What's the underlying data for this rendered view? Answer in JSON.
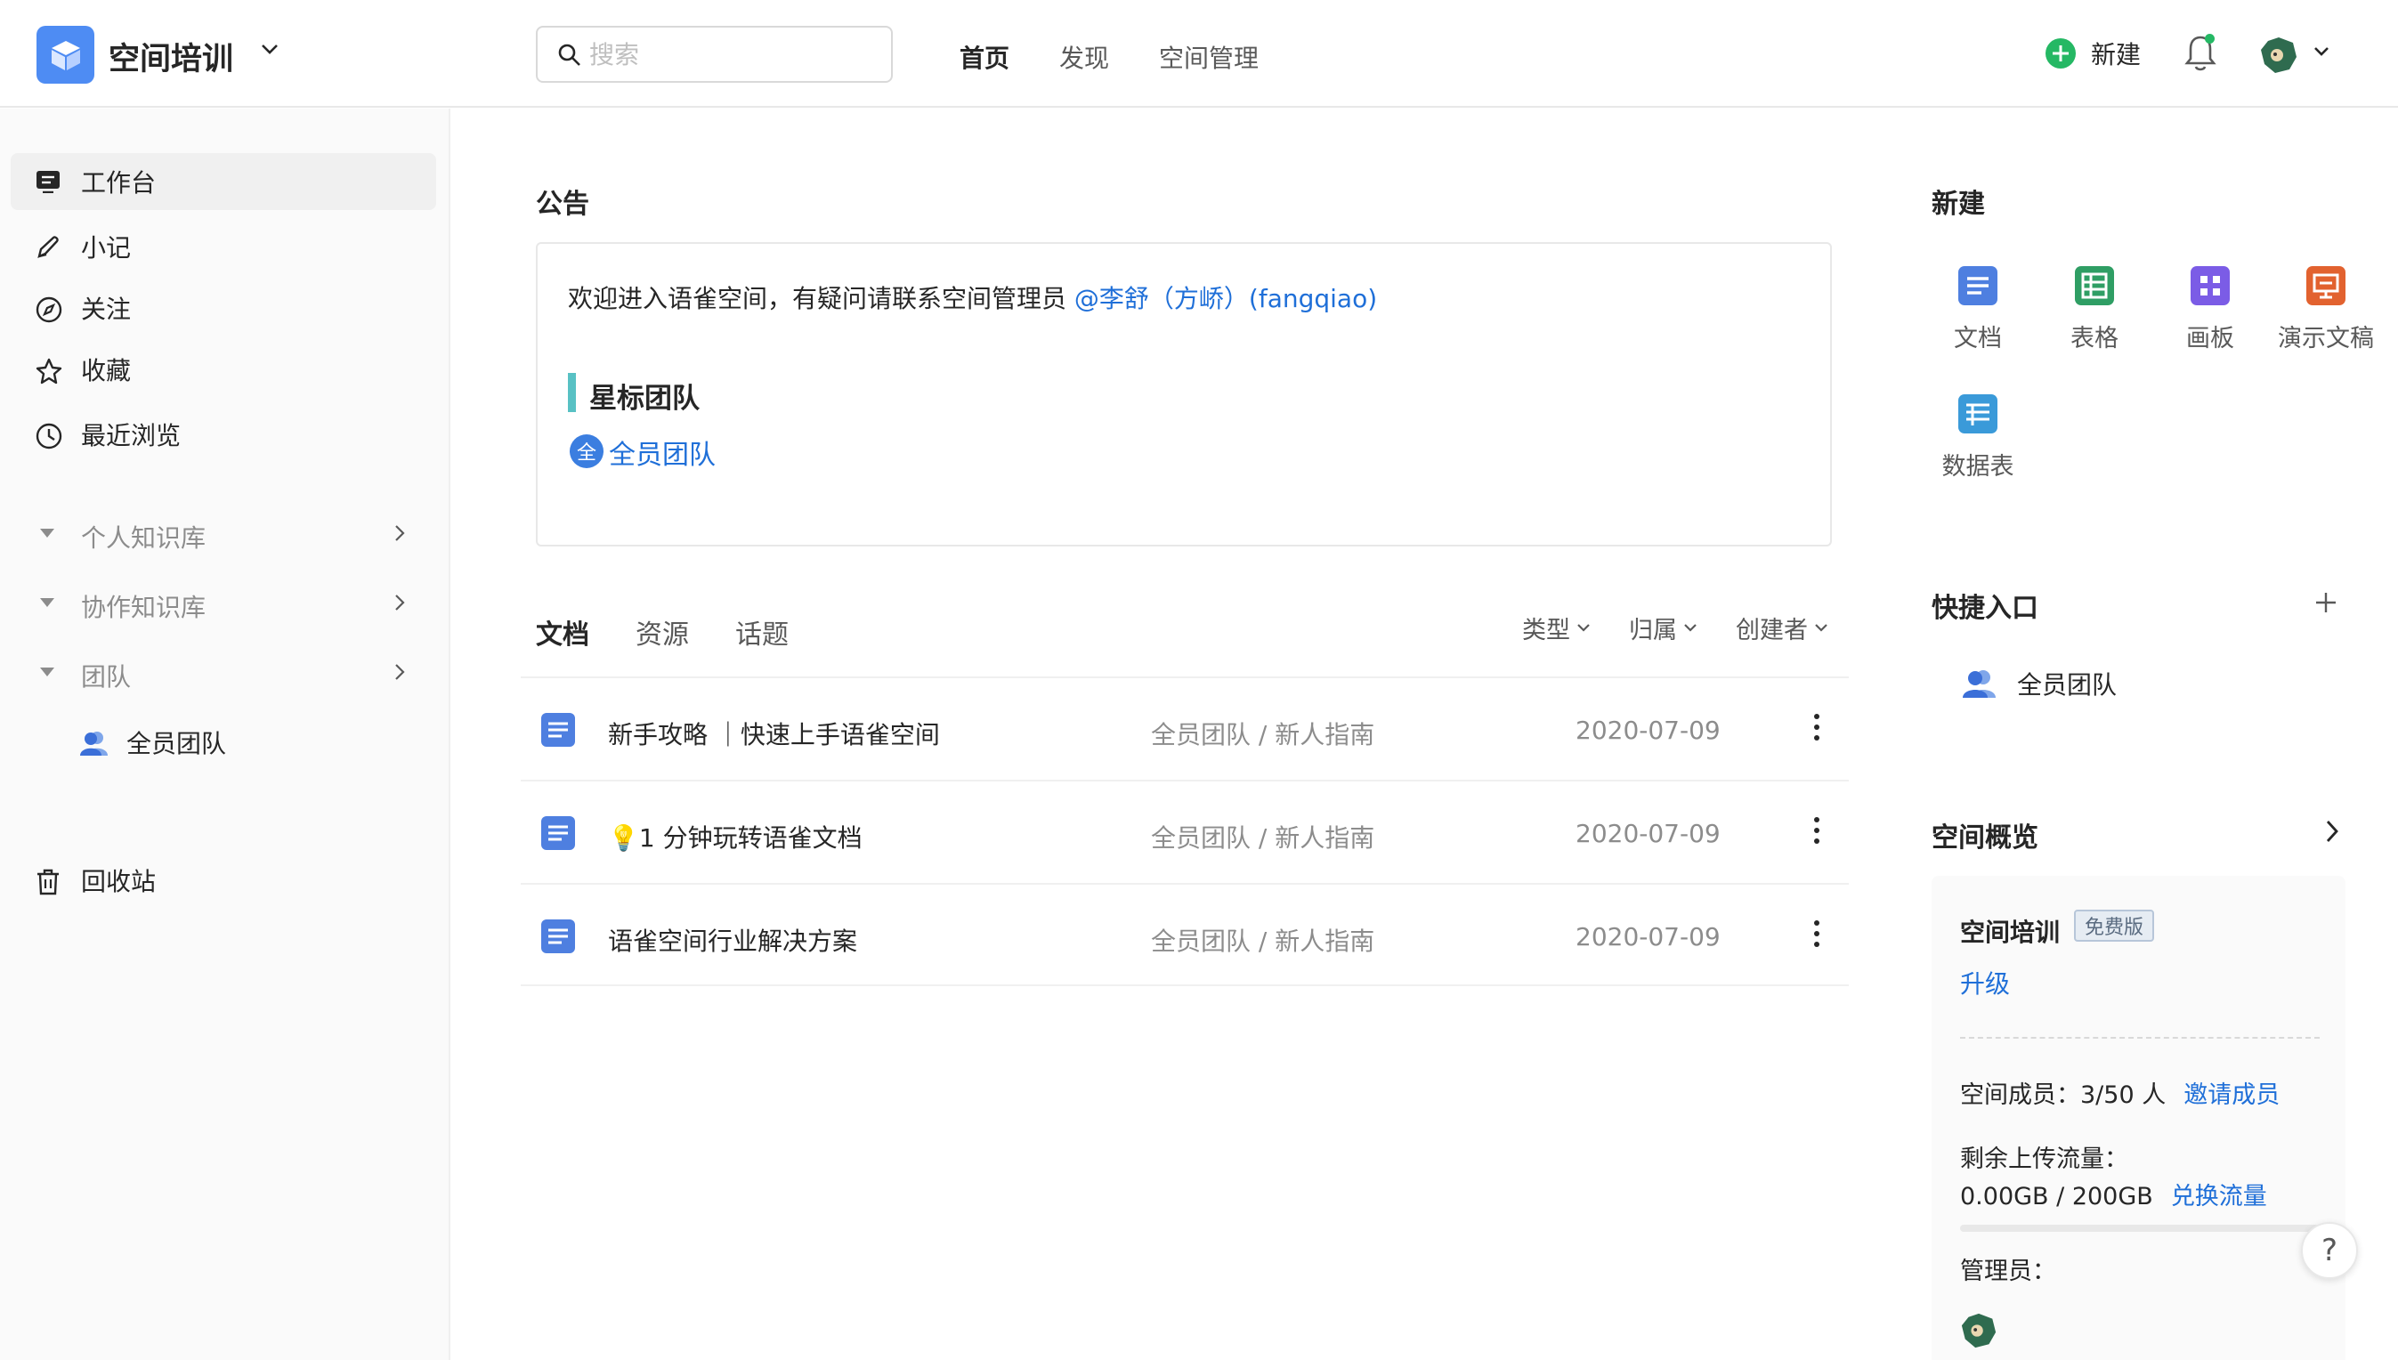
{
  "header": {
    "space_name": "空间培训",
    "search_placeholder": "搜索",
    "nav": [
      "首页",
      "发现",
      "空间管理"
    ],
    "new_label": "新建"
  },
  "sidebar": {
    "items": [
      {
        "label": "工作台",
        "icon": "workbench-icon"
      },
      {
        "label": "小记",
        "icon": "pen-icon"
      },
      {
        "label": "关注",
        "icon": "compass-icon"
      },
      {
        "label": "收藏",
        "icon": "star-icon"
      },
      {
        "label": "最近浏览",
        "icon": "clock-icon"
      }
    ],
    "groups": [
      "个人知识库",
      "协作知识库",
      "团队"
    ],
    "team_item": "全员团队",
    "trash": "回收站"
  },
  "notice": {
    "title": "公告",
    "text": "欢迎进入语雀空间，有疑问请联系空间管理员",
    "mention": "@李舒（方峤）(fangqiao)",
    "star_title": "星标团队",
    "team_badge": "全",
    "team_name": "全员团队"
  },
  "tabs": [
    "文档",
    "资源",
    "话题"
  ],
  "filters": [
    "类型",
    "归属",
    "创建者"
  ],
  "docs": [
    {
      "title": "新手攻略 ｜快速上手语雀空间",
      "path": "全员团队 / 新人指南",
      "date": "2020-07-09"
    },
    {
      "title": "💡1 分钟玩转语雀文档",
      "path": "全员团队 / 新人指南",
      "date": "2020-07-09"
    },
    {
      "title": "语雀空间行业解决方案",
      "path": "全员团队 / 新人指南",
      "date": "2020-07-09"
    }
  ],
  "create": {
    "title": "新建",
    "items": [
      {
        "label": "文档",
        "color": "#4e7fe0"
      },
      {
        "label": "表格",
        "color": "#2f9e64"
      },
      {
        "label": "画板",
        "color": "#7b5ce6"
      },
      {
        "label": "演示文稿",
        "color": "#e2622f"
      },
      {
        "label": "数据表",
        "color": "#3a9ad9"
      }
    ]
  },
  "quick": {
    "title": "快捷入口",
    "items": [
      "全员团队"
    ]
  },
  "overview": {
    "title": "空间概览",
    "space_name": "空间培训",
    "plan_badge": "免费版",
    "upgrade": "升级",
    "members_label": "空间成员：3/50 人",
    "invite": "邀请成员",
    "upload_label": "剩余上传流量：",
    "upload_value": "0.00GB / 200GB",
    "exchange": "兑换流量",
    "upload_used_fraction": 1.0,
    "admin_label": "管理员："
  },
  "help": "?"
}
